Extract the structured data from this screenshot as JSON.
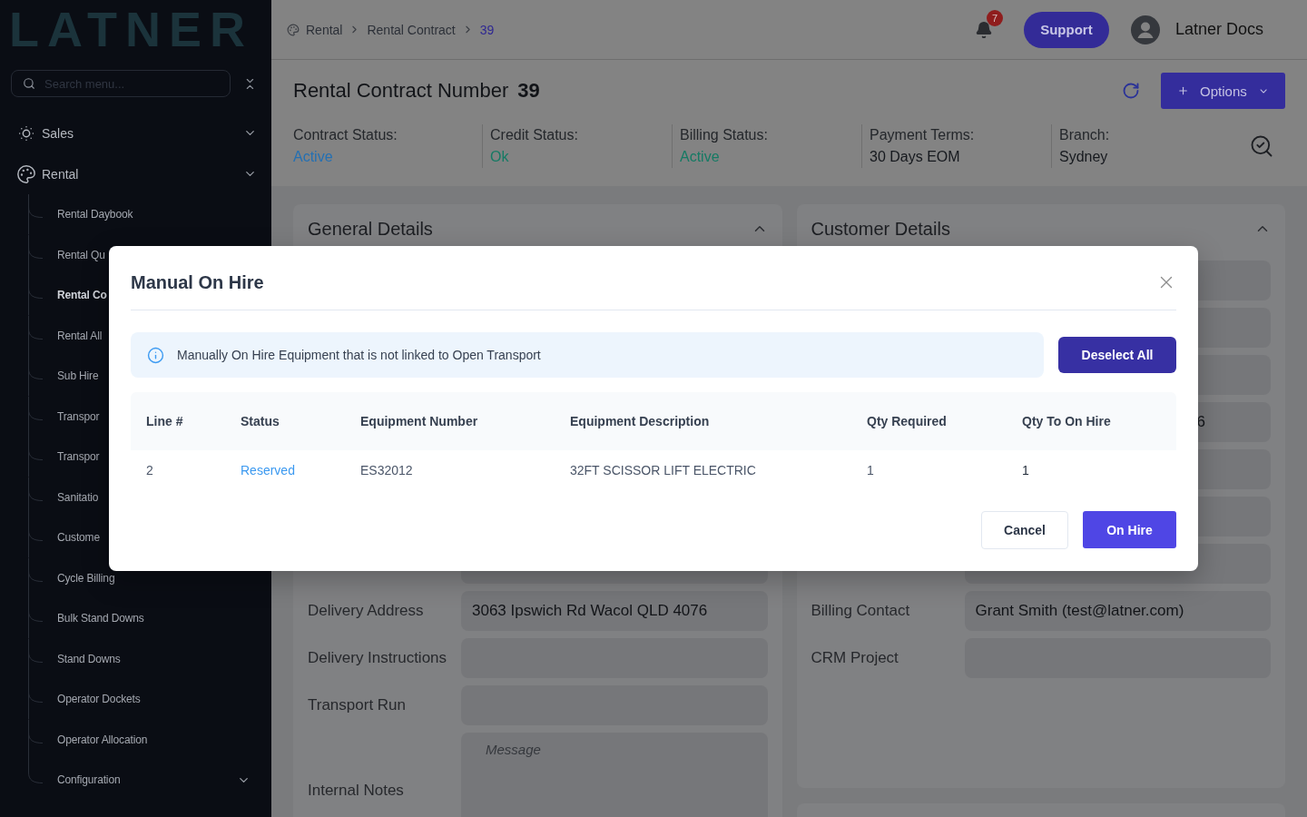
{
  "sidebar": {
    "logo": "LATNER",
    "search": {
      "placeholder": "Search menu..."
    },
    "items": [
      {
        "label": "Sales",
        "kind": "group",
        "selected": false
      },
      {
        "label": "Rental",
        "kind": "group",
        "selected": false,
        "children": [
          {
            "label": "Rental Daybook",
            "kind": "link",
            "selected": false
          },
          {
            "label": "Rental Qu",
            "kind": "link",
            "selected": false
          },
          {
            "label": "Rental Co",
            "kind": "link",
            "selected": true
          },
          {
            "label": "Rental All",
            "kind": "link",
            "selected": false
          },
          {
            "label": "Sub Hire",
            "kind": "link",
            "selected": false
          },
          {
            "label": "Transpor",
            "kind": "link",
            "selected": false
          },
          {
            "label": "Transpor",
            "kind": "link",
            "selected": false
          },
          {
            "label": "Sanitatio",
            "kind": "link",
            "selected": false
          },
          {
            "label": "Custome",
            "kind": "link",
            "selected": false
          },
          {
            "label": "Cycle Billing",
            "kind": "link",
            "selected": false
          },
          {
            "label": "Bulk Stand Downs",
            "kind": "link",
            "selected": false
          },
          {
            "label": "Stand Downs",
            "kind": "link",
            "selected": false
          },
          {
            "label": "Operator Dockets",
            "kind": "link",
            "selected": false
          },
          {
            "label": "Operator Allocation",
            "kind": "link",
            "selected": false
          },
          {
            "label": "Configuration",
            "kind": "group",
            "selected": false
          }
        ]
      }
    ]
  },
  "header": {
    "breadcrumb": [
      "Rental",
      "Rental Contract",
      "39"
    ],
    "notification_count": "7",
    "support_button": "Support",
    "user_name": "Latner Docs"
  },
  "contract": {
    "title": "Rental Contract Number",
    "number": "39",
    "options_button": "Options",
    "statuses": [
      {
        "label": "Contract Status:",
        "value": "Active",
        "color": "#2470b3"
      },
      {
        "label": "Credit Status:",
        "value": "Ok",
        "color": "#157a64"
      },
      {
        "label": "Billing Status:",
        "value": "Active",
        "color": "#157a64"
      },
      {
        "label": "Payment Terms:",
        "value": "30 Days EOM",
        "color": "#16191e"
      },
      {
        "label": "Branch:",
        "value": "Sydney",
        "color": "#16191e"
      }
    ]
  },
  "general_details": {
    "title": "General Details",
    "expanded": true,
    "fields": [
      {
        "kind": "input"
      },
      {
        "kind": "input",
        "label": "Delivery Address",
        "value": "3063 Ipswich Rd Wacol QLD 4076"
      },
      {
        "kind": "input",
        "label": "Delivery Instructions"
      },
      {
        "kind": "input",
        "label": "Transport Run"
      },
      {
        "kind": "textarea",
        "label": "Internal Notes",
        "placeholder": "Message"
      }
    ]
  },
  "customer_details": {
    "title": "Customer Details",
    "expanded": true,
    "fields": [
      {
        "kind": "input"
      },
      {
        "kind": "input"
      },
      {
        "kind": "input"
      },
      {
        "kind": "input",
        "value": "6"
      },
      {
        "kind": "input"
      },
      {
        "kind": "input"
      },
      {
        "kind": "input"
      },
      {
        "kind": "input",
        "label": "Billing Contact",
        "value": "Grant Smith (test@latner.com)"
      },
      {
        "kind": "input",
        "label": "CRM Project"
      }
    ]
  },
  "dialog": {
    "title": "Manual On Hire",
    "notice": "Manually On Hire Equipment that is not linked to Open Transport",
    "deselect_button": "Deselect All",
    "table": {
      "columns": [
        "Line #",
        "Status",
        "Equipment Number",
        "Equipment Description",
        "Qty Required",
        "Qty To On Hire"
      ],
      "rows": [
        {
          "cells": [
            "2",
            "Reserved",
            "ES32012",
            "32FT SCISSOR LIFT ELECTRIC",
            "1",
            "1"
          ],
          "color": "#3b99f0"
        }
      ]
    },
    "buttons": [
      {
        "label": "Cancel",
        "kind": "secondary"
      },
      {
        "label": "On Hire",
        "kind": "primary"
      }
    ]
  }
}
